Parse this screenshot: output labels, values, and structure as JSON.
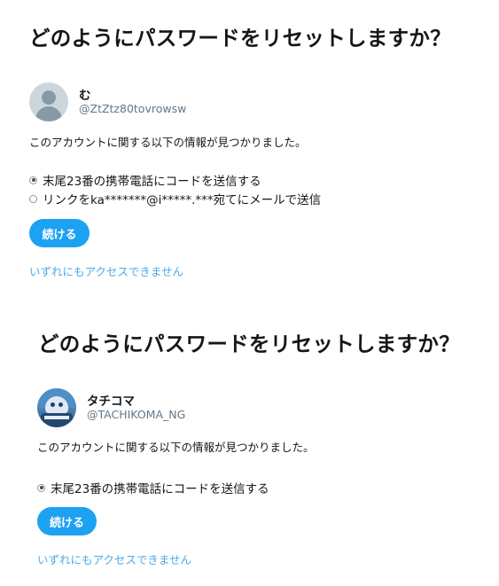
{
  "panels": [
    {
      "title": "どのようにパスワードをリセットしますか？",
      "name": "む",
      "handle": "@ZtZtz80tovrowsw",
      "info": "このアカウントに関する以下の情報が見つかりました。",
      "options": [
        {
          "label": "末尾23番の携帯電話にコードを送信する",
          "selected": true
        },
        {
          "label": "リンクをka*******@i*****.***宛てにメールで送信",
          "selected": false
        }
      ],
      "continue_label": "続ける",
      "no_access_label": "いずれにもアクセスできません",
      "avatar_icon": "default-profile-icon"
    },
    {
      "title": "どのようにパスワードをリセットしますか？",
      "name": "タチコマ",
      "handle": "@TACHIKOMA_NG",
      "info": "このアカウントに関する以下の情報が見つかりました。",
      "options": [
        {
          "label": "末尾23番の携帯電話にコードを送信する",
          "selected": true
        }
      ],
      "continue_label": "続ける",
      "no_access_label": "いずれにもアクセスできません",
      "avatar_icon": "tachikoma-avatar"
    }
  ],
  "colors": {
    "accent": "#1da1f2",
    "link": "#4faae6",
    "secondary_text": "#657786"
  }
}
